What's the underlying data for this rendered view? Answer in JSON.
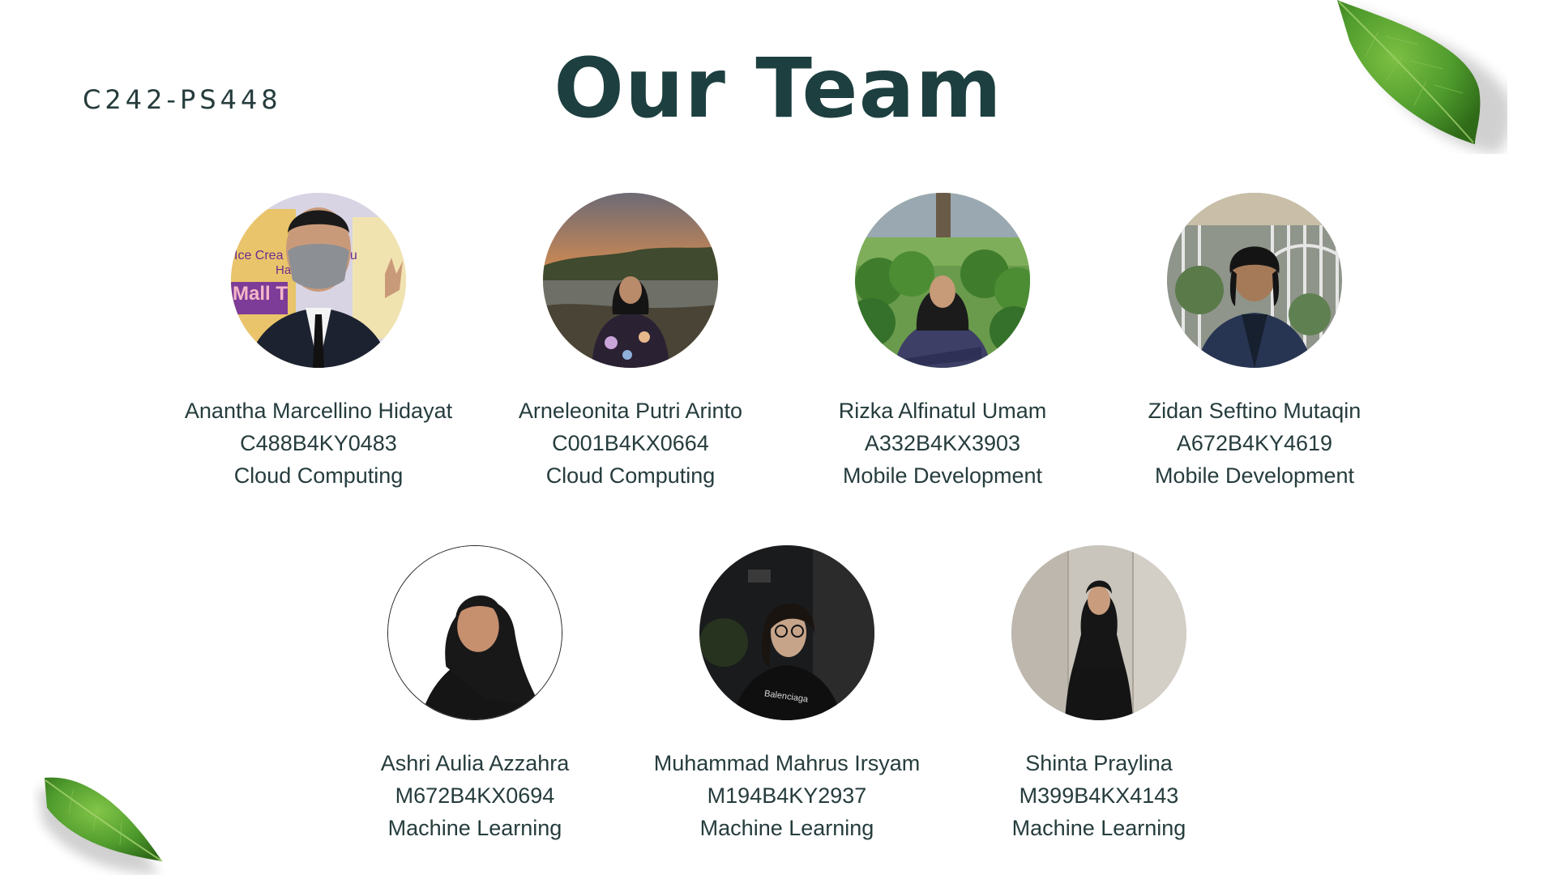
{
  "header": {
    "team_code": "C242-PS448",
    "title": "Our Team"
  },
  "members": [
    {
      "name": "Anantha Marcellino Hidayat",
      "id": "C488B4KY0483",
      "path": "Cloud Computing"
    },
    {
      "name": "Arneleonita Putri Arinto",
      "id": "C001B4KX0664",
      "path": "Cloud Computing"
    },
    {
      "name": "Rizka Alfinatul Umam",
      "id": "A332B4KX3903",
      "path": "Mobile Development"
    },
    {
      "name": "Zidan Seftino Mutaqin",
      "id": "A672B4KY4619",
      "path": "Mobile Development"
    },
    {
      "name": "Ashri Aulia Azzahra",
      "id": "M672B4KX0694",
      "path": "Machine Learning"
    },
    {
      "name": "Muhammad Mahrus Irsyam",
      "id": "M194B4KY2937",
      "path": "Machine Learning"
    },
    {
      "name": "Shinta Praylina",
      "id": "M399B4KX4143",
      "path": "Machine Learning"
    }
  ],
  "photo_texts": {
    "banner_line1": "Ice Crea",
    "banner_line1b": "nu",
    "banner_line2": "Ha",
    "banner_line3": "Mall T",
    "shirt_text": "Balenciaga"
  },
  "colors": {
    "title": "#1d3f40",
    "text": "#263c3d",
    "leaf": "#4a8a2a"
  }
}
